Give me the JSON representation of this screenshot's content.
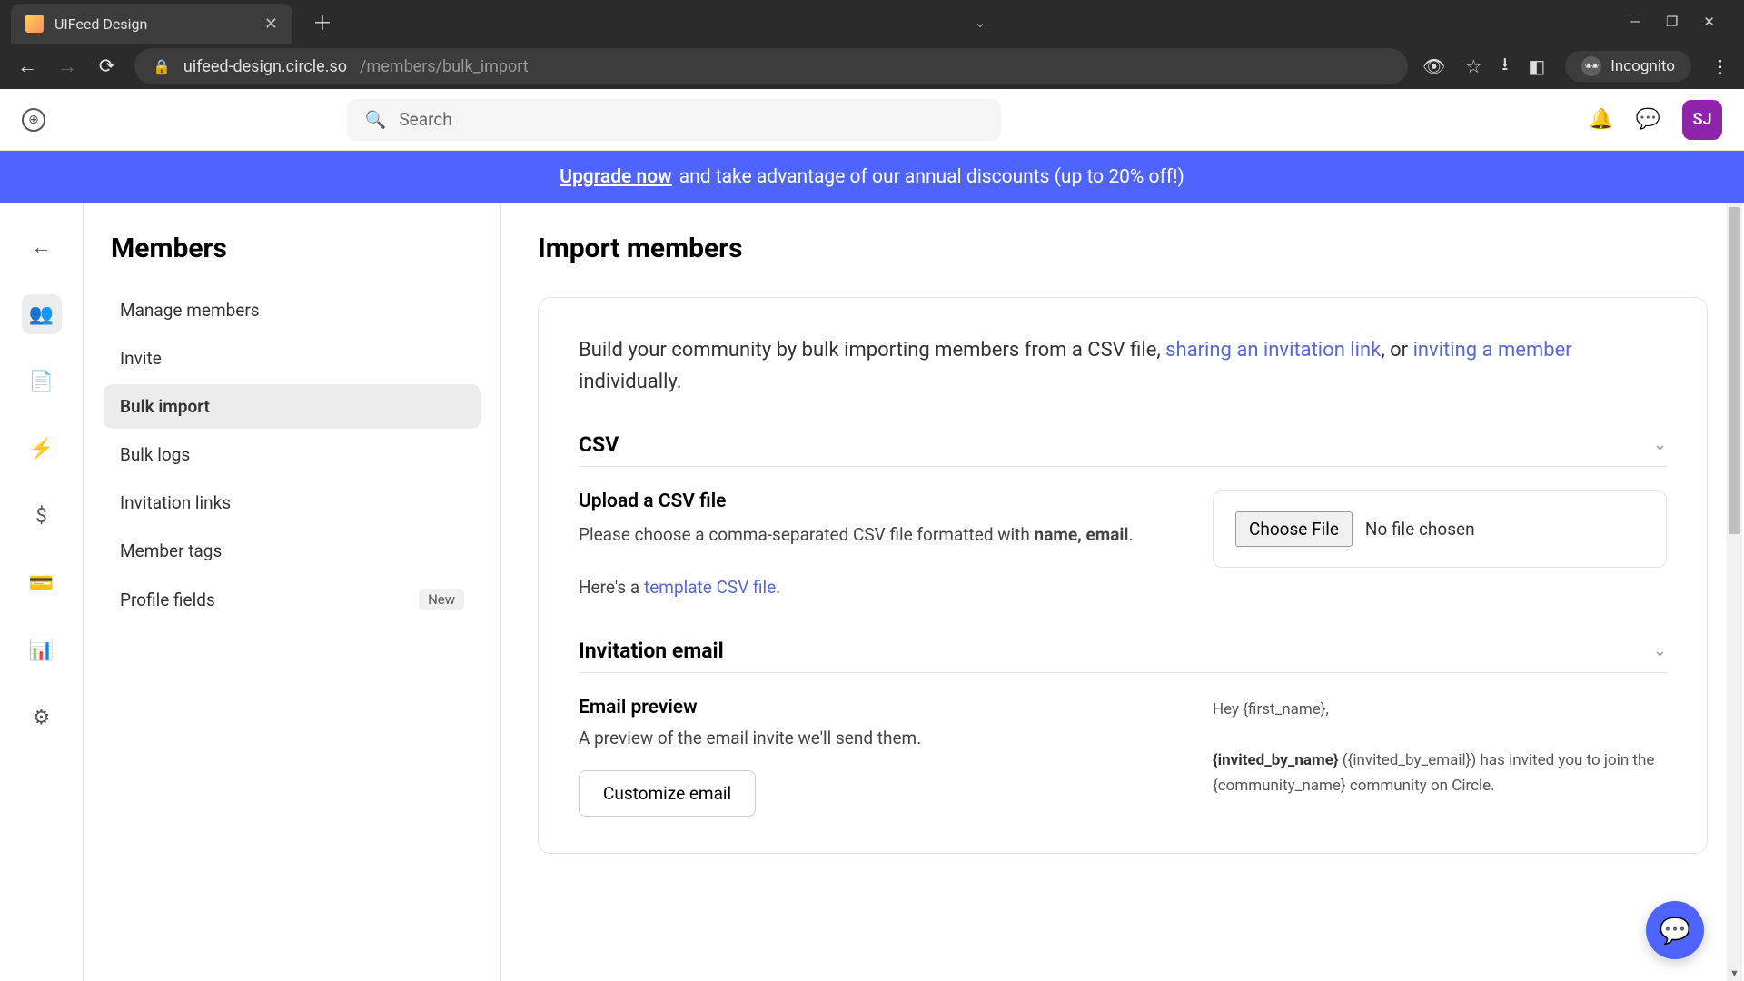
{
  "browser": {
    "tab_title": "UIFeed Design",
    "url_host": "uifeed-design.circle.so",
    "url_path": "/members/bulk_import",
    "incognito_label": "Incognito"
  },
  "header": {
    "search_placeholder": "Search",
    "avatar_initials": "SJ"
  },
  "banner": {
    "link": "Upgrade now",
    "text": " and take advantage of our annual discounts (up to 20% off!)"
  },
  "sidebar": {
    "title": "Members",
    "items": [
      {
        "label": "Manage members"
      },
      {
        "label": "Invite"
      },
      {
        "label": "Bulk import",
        "active": true
      },
      {
        "label": "Bulk logs"
      },
      {
        "label": "Invitation links"
      },
      {
        "label": "Member tags"
      },
      {
        "label": "Profile fields",
        "badge": "New"
      }
    ]
  },
  "main": {
    "title": "Import members",
    "intro_pre": "Build your community by bulk importing members from a CSV file, ",
    "intro_link1": "sharing an invitation link",
    "intro_mid": ", or ",
    "intro_link2": "inviting a member",
    "intro_post": " individually.",
    "csv": {
      "heading": "CSV",
      "upload_title": "Upload a CSV file",
      "upload_desc_pre": "Please choose a comma-separated CSV file formatted with ",
      "upload_desc_bold": "name, email",
      "upload_desc_post": ".",
      "template_pre": "Here's a ",
      "template_link": "template CSV file",
      "template_post": ".",
      "choose_label": "Choose File",
      "no_file": "No file chosen"
    },
    "email": {
      "heading": "Invitation email",
      "preview_title": "Email preview",
      "preview_desc": "A preview of the email invite we'll send them.",
      "customize_label": "Customize email",
      "body_greet": "Hey {first_name},",
      "body_line_bold": "{invited_by_name}",
      "body_line_rest": " ({invited_by_email}) has invited you to join the {community_name} community on Circle."
    }
  }
}
